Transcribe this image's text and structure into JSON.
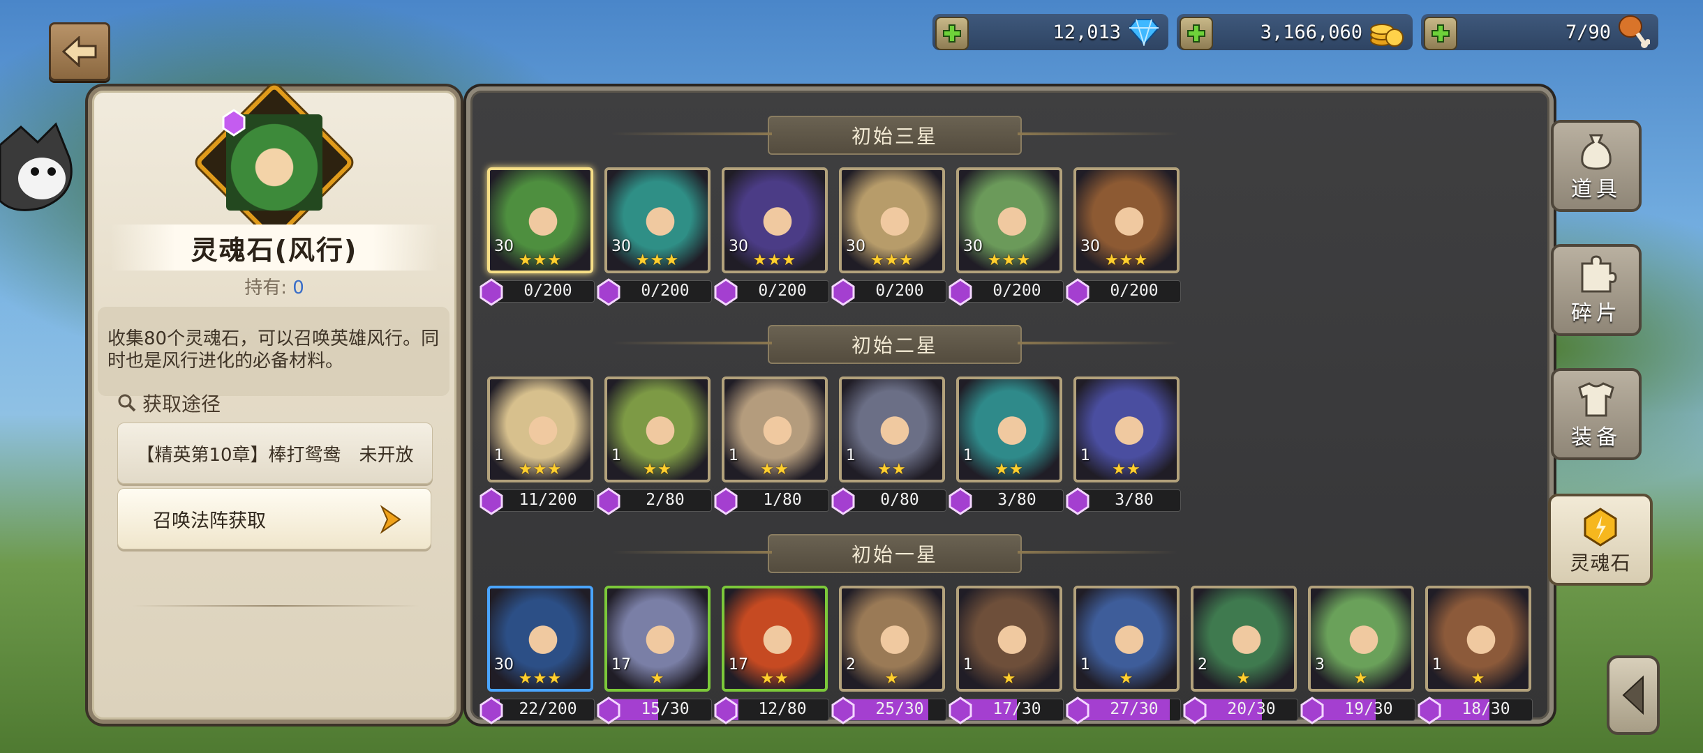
{
  "topbar": {
    "diamonds": "12,013",
    "gold": "3,166,060",
    "stamina": "7/90"
  },
  "detail": {
    "name": "灵魂石(风行)",
    "hold_label": "持有:",
    "hold_count": "0",
    "description": "收集80个灵魂石，可以召唤英雄风行。同时也是风行进化的必备材料。",
    "source_label": "获取途径",
    "source1_text": "【精英第10章】棒打鸳鸯",
    "source1_status": "未开放",
    "source2_text": "召唤法阵获取"
  },
  "sections": [
    "初始三星",
    "初始二星",
    "初始一星"
  ],
  "heroes": [
    {
      "level": "30",
      "stars": "★★★",
      "progress": "0/200",
      "fill": 0,
      "color": "#4e8f3f"
    },
    {
      "level": "30",
      "stars": "★★★",
      "progress": "0/200",
      "fill": 0,
      "color": "#2f8f86"
    },
    {
      "level": "30",
      "stars": "★★★",
      "progress": "0/200",
      "fill": 0,
      "color": "#4b3c86"
    },
    {
      "level": "30",
      "stars": "★★★",
      "progress": "0/200",
      "fill": 0,
      "color": "#b79c6a"
    },
    {
      "level": "30",
      "stars": "★★★",
      "progress": "0/200",
      "fill": 0,
      "color": "#6b9a5a"
    },
    {
      "level": "30",
      "stars": "★★★",
      "progress": "0/200",
      "fill": 0,
      "color": "#8d5a33"
    },
    {
      "level": "1",
      "stars": "★★★",
      "progress": "11/200",
      "fill": 0.055,
      "color": "#d7c08d"
    },
    {
      "level": "1",
      "stars": "★★",
      "progress": "2/80",
      "fill": 0.025,
      "color": "#7d9a45"
    },
    {
      "level": "1",
      "stars": "★★",
      "progress": "1/80",
      "fill": 0.0125,
      "color": "#b49c7d"
    },
    {
      "level": "1",
      "stars": "★★",
      "progress": "0/80",
      "fill": 0,
      "color": "#6b6f86"
    },
    {
      "level": "1",
      "stars": "★★",
      "progress": "3/80",
      "fill": 0.0375,
      "color": "#2f8a8a"
    },
    {
      "level": "1",
      "stars": "★★",
      "progress": "3/80",
      "fill": 0.0375,
      "color": "#4a4ea0"
    },
    {
      "level": "30",
      "stars": "★★★",
      "progress": "22/200",
      "fill": 0.11,
      "color": "#2c4f86"
    },
    {
      "level": "17",
      "stars": "★",
      "progress": "15/30",
      "fill": 0.5,
      "color": "#7a7fa6"
    },
    {
      "level": "17",
      "stars": "★★",
      "progress": "12/80",
      "fill": 0.15,
      "color": "#c64a22"
    },
    {
      "level": "2",
      "stars": "★",
      "progress": "25/30",
      "fill": 0.833,
      "color": "#9a7a56"
    },
    {
      "level": "1",
      "stars": "★",
      "progress": "17/30",
      "fill": 0.567,
      "color": "#6e4f3a"
    },
    {
      "level": "1",
      "stars": "★",
      "progress": "27/30",
      "fill": 0.9,
      "color": "#3e5d9a"
    },
    {
      "level": "2",
      "stars": "★",
      "progress": "20/30",
      "fill": 0.667,
      "color": "#3f7a4f"
    },
    {
      "level": "3",
      "stars": "★",
      "progress": "19/30",
      "fill": 0.633,
      "color": "#6aa15a"
    },
    {
      "level": "1",
      "stars": "★",
      "progress": "18/30",
      "fill": 0.6,
      "color": "#8c5a3a"
    }
  ],
  "tabs": [
    "道具",
    "碎片",
    "装备",
    "灵魂石"
  ],
  "colors": {
    "accent_purple": "#a43fd0",
    "star": "#ffcf2e",
    "selected_border": "#f6de86"
  },
  "icons": [
    "back-arrow-icon",
    "diamond-icon",
    "gold-coin-icon",
    "drumstick-icon",
    "search-icon",
    "soul-gem-icon"
  ]
}
